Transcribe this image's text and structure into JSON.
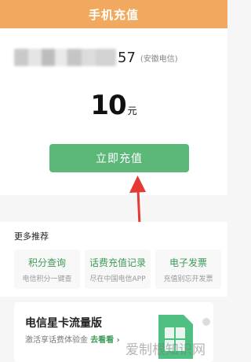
{
  "header": {
    "title": "手机充值"
  },
  "phone": {
    "number_tail": "57",
    "operator": "(安徽电信)"
  },
  "amount": {
    "value": "10",
    "unit": "元"
  },
  "recharge_button": {
    "label": "立即充值"
  },
  "more": {
    "title": "更多推荐",
    "items": [
      {
        "title": "积分查询",
        "subtitle": "电信积分一键查"
      },
      {
        "title": "话费充值记录",
        "subtitle": "尽在中国电信APP"
      },
      {
        "title": "电子发票",
        "subtitle": "充值别忘开发票"
      }
    ]
  },
  "banner": {
    "title": "电信星卡流量版",
    "subtitle": "激活享话费体验金",
    "link": "去看看"
  },
  "watermark": {
    "text": "爱制根知识网"
  },
  "colors": {
    "header": "#f0a95e",
    "primary_green": "#5cb878",
    "link_green": "#3d9a57",
    "arrow": "#e53935"
  },
  "icons": [
    "sim-card-icon",
    "chevron-right-icon",
    "red-arrow-annotation"
  ]
}
